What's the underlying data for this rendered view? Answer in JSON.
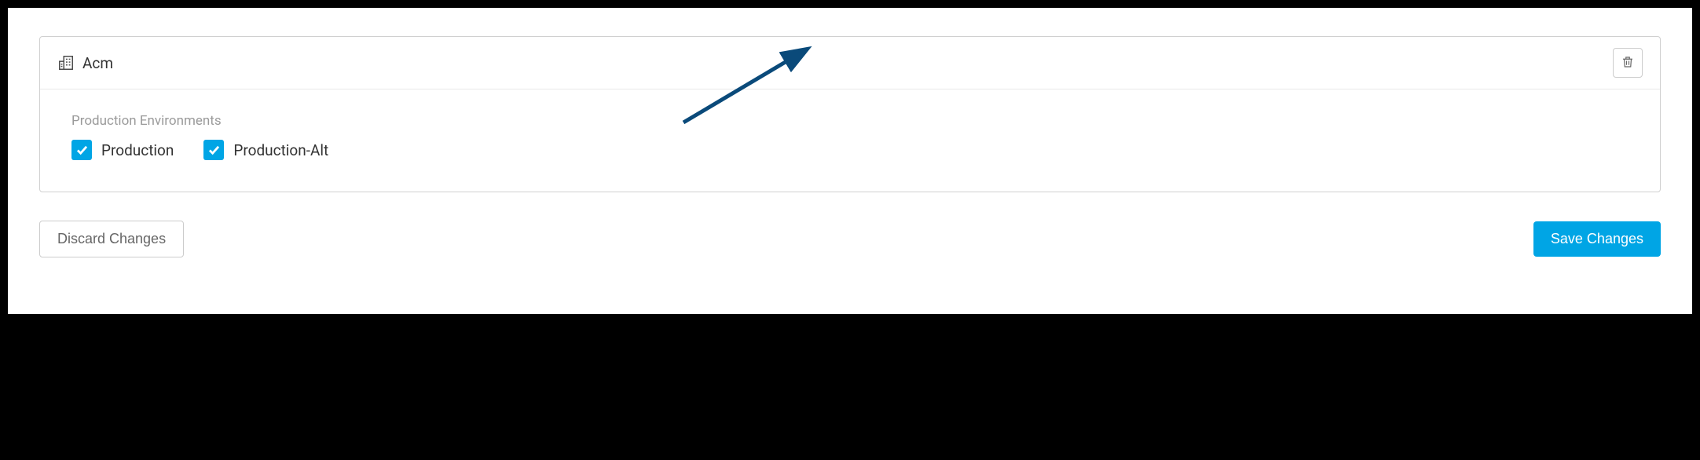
{
  "card": {
    "title": "Acm",
    "section_label": "Production Environments",
    "environments": [
      {
        "label": "Production",
        "checked": true
      },
      {
        "label": "Production-Alt",
        "checked": true
      }
    ]
  },
  "actions": {
    "discard_label": "Discard Changes",
    "save_label": "Save Changes"
  }
}
